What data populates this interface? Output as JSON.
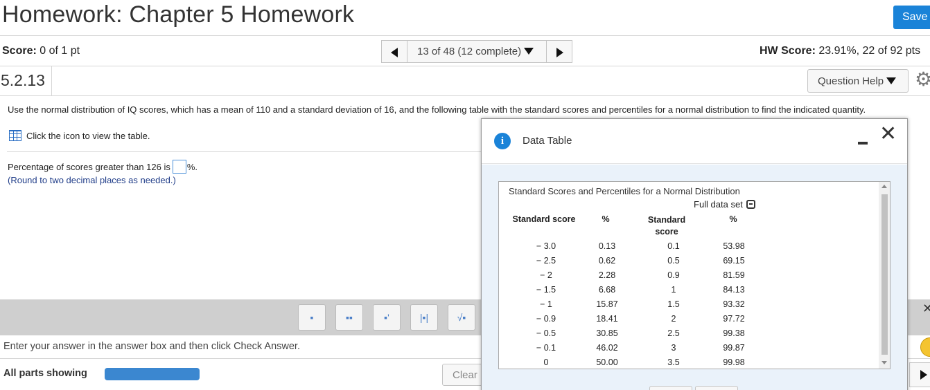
{
  "header": {
    "title": "Homework: Chapter 5 Homework",
    "save_label": "Save"
  },
  "scorebar": {
    "score_label": "Score:",
    "score_value": " 0 of 1 pt",
    "nav_position": "13 of 48 (12 complete)",
    "hw_label": "HW Score:",
    "hw_value": " 23.91%, 22 of 92 pts"
  },
  "question": {
    "number": "5.2.13",
    "help_label": "Question Help",
    "prompt": "Use the normal distribution of IQ scores, which has a mean of 110 and a standard deviation of 16, and the following table with the standard scores and percentiles for a normal distribution to find the indicated quantity.",
    "table_link": "Click the icon to view the table.",
    "answer_prefix": "Percentage of scores greater than 126 is",
    "answer_suffix": "%.",
    "answer_value": "",
    "round_note": "(Round to two decimal places as needed.)"
  },
  "footer": {
    "instructions": "Enter your answer in the answer box and then click Check Answer.",
    "all_parts": "All parts showing",
    "clear_label": "Clear",
    "progress_fraction": 1
  },
  "toolbar": {
    "buttons": [
      "fraction-icon",
      "mixed-number-icon",
      "exponent-icon",
      "absolute-value-icon",
      "sqrt-icon"
    ]
  },
  "dialog": {
    "title": "Data Table",
    "table_title": "Standard Scores and Percentiles for a Normal Distribution",
    "full_data_set": "Full data set",
    "col_headers": [
      "Standard score",
      "%",
      "Standard score",
      "%"
    ],
    "rows_left": [
      [
        "− 3.0",
        "0.13"
      ],
      [
        "− 2.5",
        "0.62"
      ],
      [
        "− 2",
        "2.28"
      ],
      [
        "− 1.5",
        "6.68"
      ],
      [
        "− 1",
        "15.87"
      ],
      [
        "− 0.9",
        "18.41"
      ],
      [
        "− 0.5",
        "30.85"
      ],
      [
        "− 0.1",
        "46.02"
      ],
      [
        "0",
        "50.00"
      ]
    ],
    "rows_right": [
      [
        "0.1",
        "53.98"
      ],
      [
        "0.5",
        "69.15"
      ],
      [
        "0.9",
        "81.59"
      ],
      [
        "1",
        "84.13"
      ],
      [
        "1.5",
        "93.32"
      ],
      [
        "2",
        "97.72"
      ],
      [
        "2.5",
        "99.38"
      ],
      [
        "3",
        "99.87"
      ],
      [
        "3.5",
        "99.98"
      ]
    ]
  },
  "colors": {
    "accent": "#1a83d8",
    "progress": "#3b87d0",
    "note": "#1f3c88"
  }
}
